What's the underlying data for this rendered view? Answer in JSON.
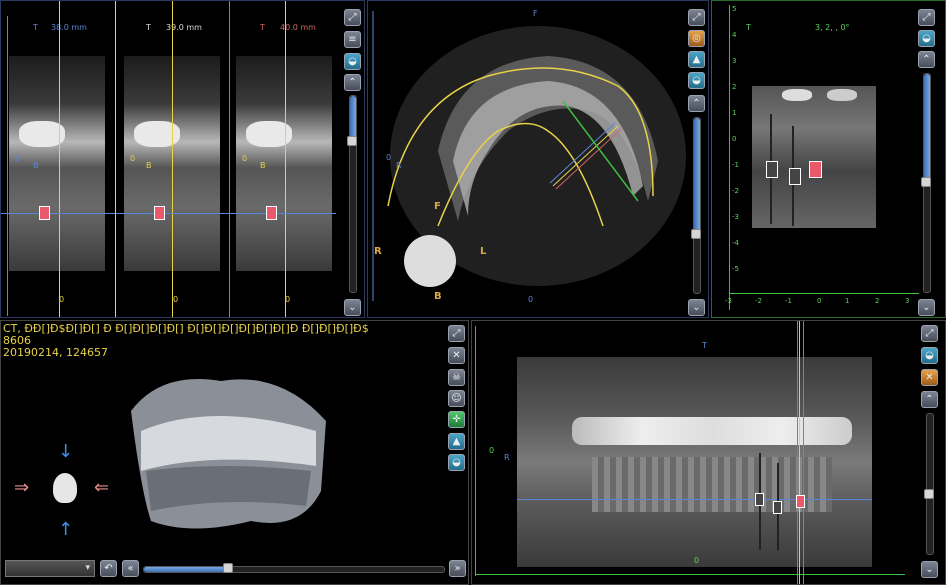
{
  "cross_sections": [
    {
      "label_t": "T",
      "thickness": "38.0 mm",
      "label_b": "B",
      "label_0": "0",
      "label_bottom": "0",
      "accent": "#5b86d6"
    },
    {
      "label_t": "T",
      "thickness": "39.0 mm",
      "label_b": "B",
      "label_0": "0",
      "label_bottom": "0",
      "accent": "#e8d24a"
    },
    {
      "label_t": "T",
      "thickness": "40.0 mm",
      "label_b": "B",
      "label_0": "0",
      "label_bottom": "0",
      "accent": "#d06464"
    }
  ],
  "axial": {
    "top_label": "F",
    "left_label": "R",
    "side_label": "R",
    "label_f": "F",
    "label_l": "L",
    "bottom_label": "B",
    "scale_zero": "0",
    "bottom_zero": "0"
  },
  "implant_view": {
    "title": "3, 2, , 0°",
    "top_label": "T",
    "y_ticks": [
      "5",
      "4",
      "3",
      "2",
      "1",
      "0",
      "-1",
      "-2",
      "-3",
      "-4",
      "-5"
    ],
    "x_ticks": [
      "-3",
      "-2",
      "-1",
      "0",
      "1",
      "2",
      "3"
    ]
  },
  "info": {
    "line1": "CT, ĐĐ[]Đ$Đ[]Đ[] Đ  Đ[]Đ[]Đ[]Đ[] Đ[]Đ[]Đ[]Đ[]Đ[]Đ[]Đ  Đ[]Đ[]Đ[]Đ$",
    "line2": "8606",
    "line3": "20190214, 124657"
  },
  "model3d": {
    "select_value": ""
  },
  "panorama": {
    "top_label": "T",
    "left_label": "R",
    "zero_label": "0",
    "bottom_zero": "0"
  },
  "colors": {
    "accent": "#e8d24a",
    "axis_blue": "#5b86d6",
    "axis_green": "#5fcf5f",
    "border": "#4c4c4c"
  }
}
